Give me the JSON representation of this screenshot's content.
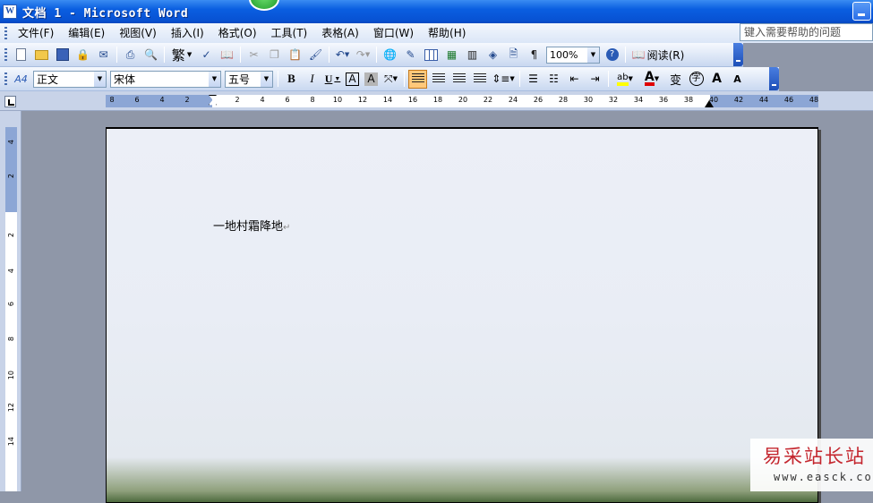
{
  "window": {
    "title": "文档 1 - Microsoft Word",
    "app_icon_letter": "W"
  },
  "menubar": {
    "items": [
      "文件(F)",
      "编辑(E)",
      "视图(V)",
      "插入(I)",
      "格式(O)",
      "工具(T)",
      "表格(A)",
      "窗口(W)",
      "帮助(H)"
    ],
    "help_placeholder": "键入需要帮助的问题"
  },
  "standard_toolbar": {
    "traditional_label": "繁",
    "zoom_value": "100%",
    "read_label": "阅读(R)"
  },
  "format_toolbar": {
    "style_icon": "A4",
    "style_value": "正文",
    "font_value": "宋体",
    "size_value": "五号",
    "bold": "B",
    "italic": "I",
    "underline": "U",
    "border_char": "A",
    "shade_char": "A",
    "pinyin_char": "变",
    "enclose_char": "字",
    "grow_char": "A",
    "shrink_char": "A",
    "highlight_char": "ab",
    "font_color_char": "A"
  },
  "ruler": {
    "h_numbers": [
      "8",
      "6",
      "4",
      "2",
      "2",
      "4",
      "6",
      "8",
      "10",
      "12",
      "14",
      "16",
      "18",
      "20",
      "22",
      "24",
      "26",
      "28",
      "30",
      "32",
      "34",
      "36",
      "38",
      "40",
      "42",
      "44",
      "46",
      "48"
    ],
    "v_numbers": [
      "4",
      "2",
      "2",
      "4",
      "6",
      "8",
      "10",
      "12",
      "14"
    ]
  },
  "document": {
    "text": "一地村霜降地",
    "para_mark": "↵"
  },
  "watermark": {
    "title": "易采站长站",
    "url": "www.easck.com"
  },
  "colors": {
    "title_bar": "#0853d4",
    "toolbar": "#dbe6f7",
    "page": "#eceff7",
    "app_background": "#8f97a8",
    "watermark_text": "#c4262e"
  }
}
